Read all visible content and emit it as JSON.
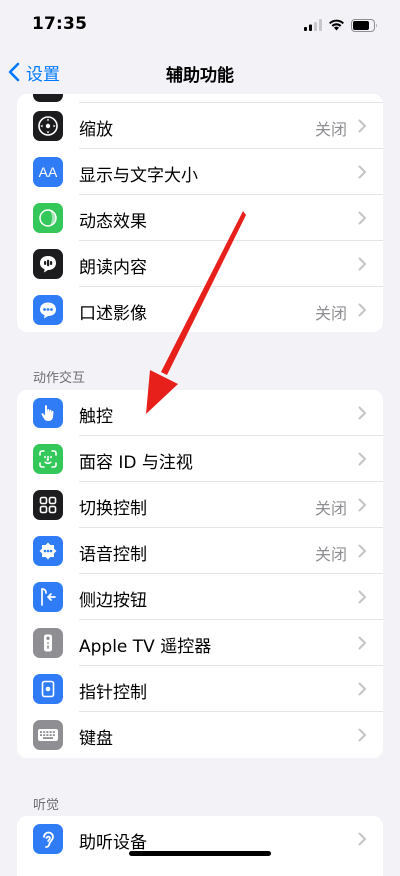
{
  "status_bar": {
    "time": "17:35"
  },
  "nav": {
    "back_label": "设置",
    "title": "辅助功能"
  },
  "vision_group": {
    "items": [
      {
        "label": "缩放",
        "value": "关闭",
        "icon": "zoom-icon",
        "color": "#1c1c1e"
      },
      {
        "label": "显示与文字大小",
        "value": "",
        "icon": "text-size-icon",
        "color": "#2f7cf6"
      },
      {
        "label": "动态效果",
        "value": "",
        "icon": "motion-icon",
        "color": "#34c759"
      },
      {
        "label": "朗读内容",
        "value": "",
        "icon": "spoken-content-icon",
        "color": "#1c1c1e"
      },
      {
        "label": "口述影像",
        "value": "关闭",
        "icon": "audio-description-icon",
        "color": "#2f7cf6"
      }
    ]
  },
  "interaction_section": {
    "header": "动作交互"
  },
  "interaction_group": {
    "items": [
      {
        "label": "触控",
        "value": "",
        "icon": "touch-hand-icon",
        "color": "#2f7cf6"
      },
      {
        "label": "面容 ID 与注视",
        "value": "",
        "icon": "face-id-icon",
        "color": "#34c759"
      },
      {
        "label": "切换控制",
        "value": "关闭",
        "icon": "switch-control-icon",
        "color": "#1c1c1e"
      },
      {
        "label": "语音控制",
        "value": "关闭",
        "icon": "voice-control-icon",
        "color": "#2f7cf6"
      },
      {
        "label": "侧边按钮",
        "value": "",
        "icon": "side-button-icon",
        "color": "#2f7cf6"
      },
      {
        "label": "Apple TV 遥控器",
        "value": "",
        "icon": "remote-icon",
        "color": "#8e8e93"
      },
      {
        "label": "指针控制",
        "value": "",
        "icon": "pointer-icon",
        "color": "#2f7cf6"
      },
      {
        "label": "键盘",
        "value": "",
        "icon": "keyboard-icon",
        "color": "#8e8e93"
      }
    ]
  },
  "hearing_section": {
    "header": "听觉"
  },
  "hearing_group": {
    "items": [
      {
        "label": "助听设备",
        "value": "",
        "icon": "hearing-device-icon",
        "color": "#2f7cf6"
      }
    ]
  },
  "annotation": {
    "arrow_color": "#e8201c"
  }
}
